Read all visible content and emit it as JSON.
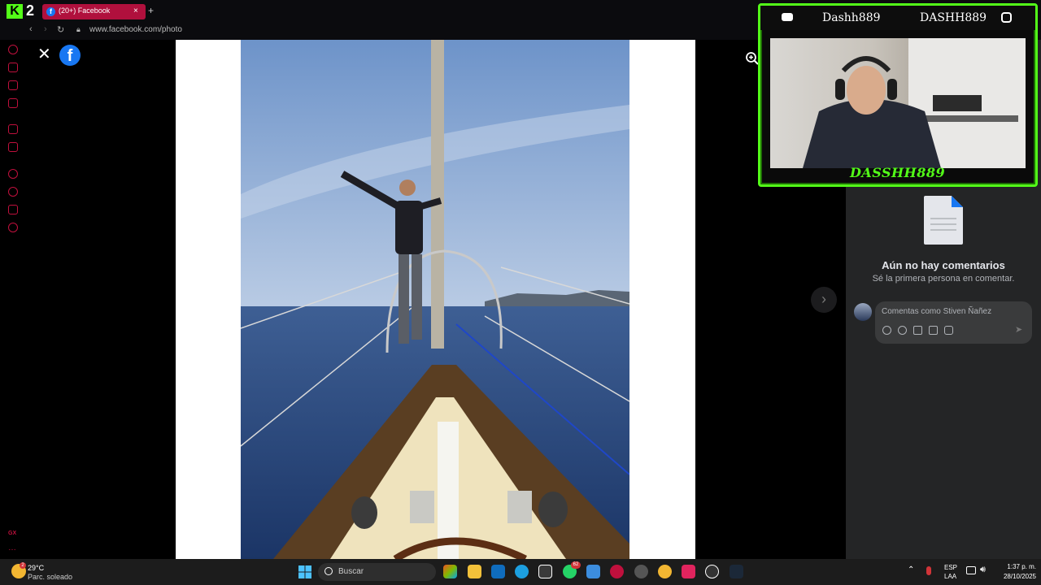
{
  "browser": {
    "kick_number": "2",
    "tab_title": "(20+) Facebook",
    "tab_close": "×",
    "new_tab": "+",
    "url": "www.facebook.com/photo"
  },
  "viewer": {
    "close_glyph": "✕",
    "fb_glyph": "f",
    "next_glyph": "›"
  },
  "comments": {
    "empty_title": "Aún no hay comentarios",
    "empty_subtitle": "Sé la primera persona en comentar.",
    "placeholder": "Comentas como Stiven Ñañez",
    "send_glyph": "➤"
  },
  "stream_overlay": {
    "name_left": "Dashh889",
    "name_right": "DASHH889",
    "banner": "DASSHH889"
  },
  "taskbar": {
    "weather_badge": "2",
    "temperature": "29°C",
    "condition": "Parc. soleado",
    "search_label": "Buscar",
    "whatsapp_badge": "62",
    "lang_line1": "ESP",
    "lang_line2": "LAA",
    "time": "1:37 p. m.",
    "date": "28/10/2025"
  },
  "colors": {
    "accent_kick": "#53fc18",
    "tab_active": "#b0103d",
    "facebook_blue": "#1877f2",
    "sidebar_icons": "#c0103d"
  }
}
